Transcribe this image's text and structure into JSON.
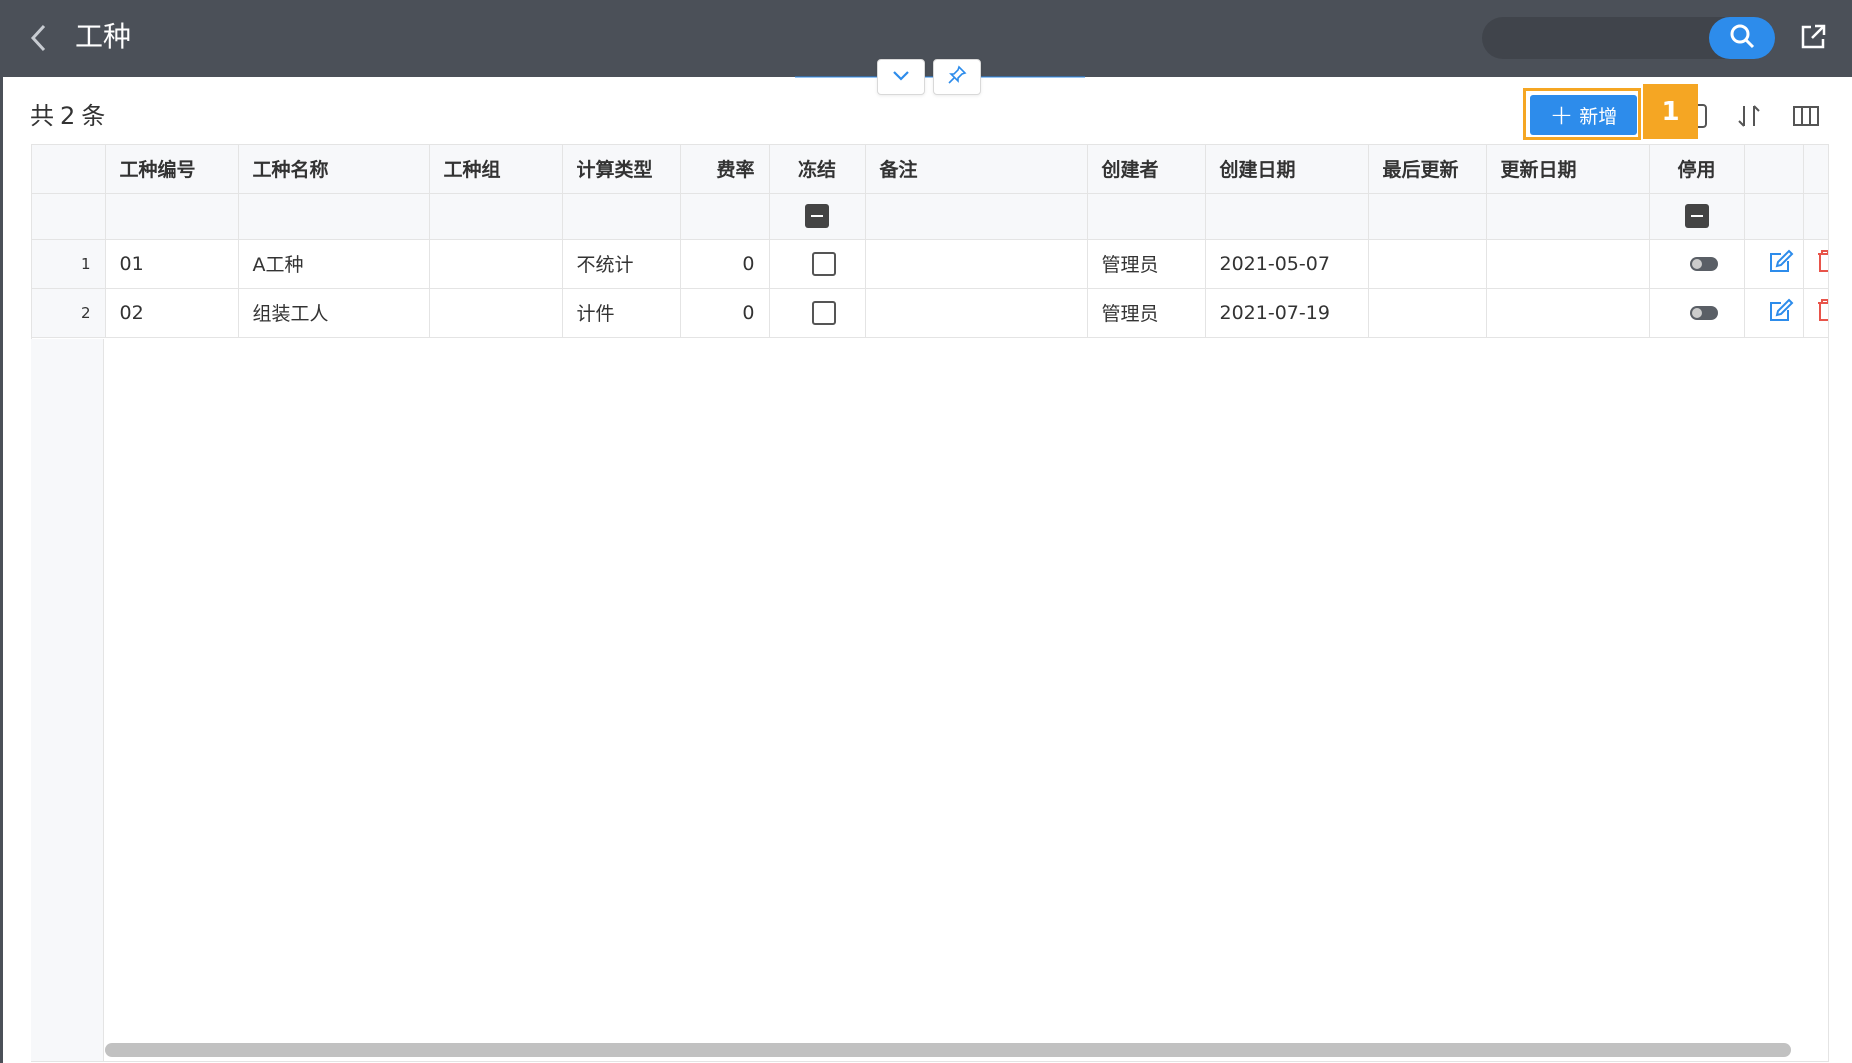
{
  "header": {
    "title": "工种",
    "back_icon": "chevron-left-icon",
    "search_icon": "search-icon",
    "export_icon": "external-link-icon",
    "accent": "#2d8ceb",
    "bg": "#4b5058"
  },
  "toolbar": {
    "total_prefix": "共",
    "total_count": "2",
    "total_suffix": "条",
    "add_label": "新增",
    "badge": "1",
    "highlight_color": "#f5a623"
  },
  "table": {
    "columns": [
      "工种编号",
      "工种名称",
      "工种组",
      "计算类型",
      "费率",
      "冻结",
      "备注",
      "创建者",
      "创建日期",
      "最后更新",
      "更新日期",
      "停用"
    ],
    "rows": [
      {
        "index": "1",
        "code": "01",
        "name": "A工种",
        "group": "",
        "calc_type": "不统计",
        "rate": "0",
        "frozen": false,
        "remark": "",
        "creator": "管理员",
        "created": "2021-05-07",
        "last_update": "",
        "update_date": "",
        "disabled": false
      },
      {
        "index": "2",
        "code": "02",
        "name": "组装工人",
        "group": "",
        "calc_type": "计件",
        "rate": "0",
        "frozen": false,
        "remark": "",
        "creator": "管理员",
        "created": "2021-07-19",
        "last_update": "",
        "update_date": "",
        "disabled": false
      }
    ]
  }
}
